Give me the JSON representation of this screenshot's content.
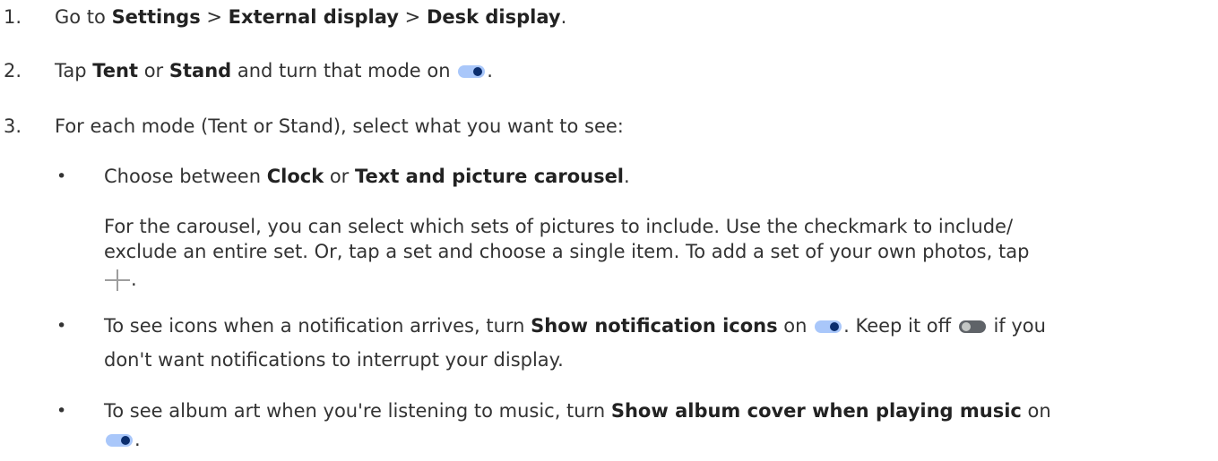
{
  "steps": [
    {
      "number": "1.",
      "p1": "Go to ",
      "b1": "Settings",
      "p2": " > ",
      "b2": "External display",
      "p3": " > ",
      "b3": "Desk display",
      "p4": "."
    },
    {
      "number": "2.",
      "p1": "Tap ",
      "b1": "Tent",
      "p2": " or ",
      "b2": "Stand",
      "p3": " and turn that mode on ",
      "p4": "."
    },
    {
      "number": "3.",
      "p1": "For each mode (Tent or Stand), select what you want to see:"
    }
  ],
  "bullets": [
    {
      "p1": "Choose between ",
      "b1": "Clock",
      "p2": " or ",
      "b2": "Text and picture carousel",
      "p3": "."
    },
    {
      "line1_p1": "To see icons when a notification arrives, turn ",
      "line1_b1": "Show notification icons",
      "line1_p2": " on ",
      "line1_p3": ". Keep it off ",
      "line1_p4": " if you",
      "line2": "don't want notifications to interrupt your display."
    },
    {
      "line1_p1": "To see album art when you're listening to music, turn ",
      "line1_b1": "Show album cover when playing music",
      "line1_p2": " on",
      "line2_p1": "."
    }
  ],
  "carousel_note": {
    "line1": "For the carousel, you can select which sets of pictures to include. Use the checkmark to include/",
    "line2": "exclude an entire set. Or, tap a set and choose a single item. To add a set of your own photos, tap",
    "line3": "."
  },
  "bullet_glyph": "•",
  "icons": {
    "toggle_on": "toggle-on-icon",
    "toggle_off": "toggle-off-icon",
    "add": "plus-icon"
  },
  "colors": {
    "text": "#333333",
    "toggle_on_track": "#a9c7fa",
    "toggle_on_knob": "#0b2e6e",
    "toggle_off_track": "#5f6368",
    "plus": "#9e9e9e"
  }
}
